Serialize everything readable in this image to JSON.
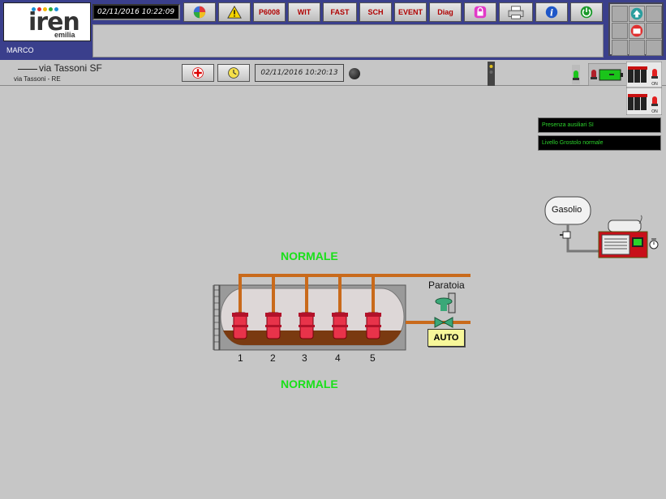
{
  "header": {
    "logo_text": "iren",
    "logo_sub": "emilia",
    "user": "MARCO",
    "datetime": "02/11/2016     10:22:09",
    "buttons": {
      "p6008": "P6008",
      "wit": "WIT",
      "fast": "FAST",
      "sch": "SCH",
      "event": "EVENT",
      "diag": "Diag"
    },
    "icons": [
      "palette-icon",
      "warning-icon",
      "lock-icon",
      "printer-icon",
      "info-icon",
      "power-icon"
    ]
  },
  "site": {
    "title": "via Tassoni SF",
    "subtitle": "via Tassoni - RE",
    "datetime": "02/11/2016 10:20:13"
  },
  "messages": [
    "Presenza ausiliari SI",
    "Livello Grostolo normale"
  ],
  "plant": {
    "state_top": "NORMALE",
    "state_bottom": "NORMALE",
    "pumps": [
      "1",
      "2",
      "3",
      "4",
      "5"
    ],
    "gate_label": "Paratoia",
    "gate_mode": "AUTO",
    "tank_label": "Gasolio"
  },
  "switch_labels": {
    "on1": "ON",
    "on2": "ON"
  },
  "colors": {
    "header_bg": "#3a3f8c",
    "background": "#c6c6c6",
    "state_ok": "#19e019",
    "message_text": "#2cd42c",
    "pump_red": "#e8334a",
    "pipe_orange": "#c96a1b",
    "auto_yellow": "#f7f79a",
    "generator_red": "#c8101a"
  }
}
